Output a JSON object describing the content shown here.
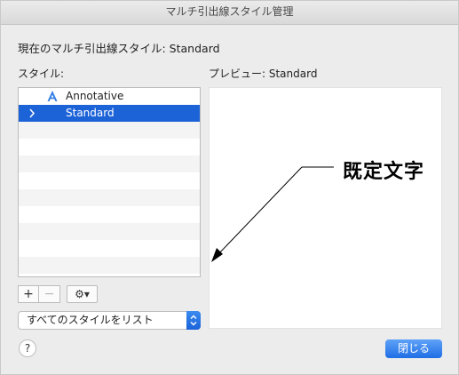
{
  "window": {
    "title": "マルチ引出線スタイル管理"
  },
  "current_style": "現在のマルチ引出線スタイル: Standard",
  "styles_label": "スタイル:",
  "preview_label": "プレビュー: Standard",
  "style_list": {
    "items": [
      {
        "label": "Annotative",
        "icon": "annotative-icon",
        "selected": false
      },
      {
        "label": "Standard",
        "icon": "chevron-right-icon",
        "selected": true
      }
    ]
  },
  "toolbar": {
    "add_label": "+",
    "remove_label": "−",
    "gear_label": "⚙︎▾"
  },
  "filter": {
    "selected": "すべてのスタイルをリスト"
  },
  "preview": {
    "text": "既定文字"
  },
  "help_label": "?",
  "close_label": "閉じる",
  "colors": {
    "accent": "#1d63d8",
    "icon_blue": "#2f7be3"
  }
}
